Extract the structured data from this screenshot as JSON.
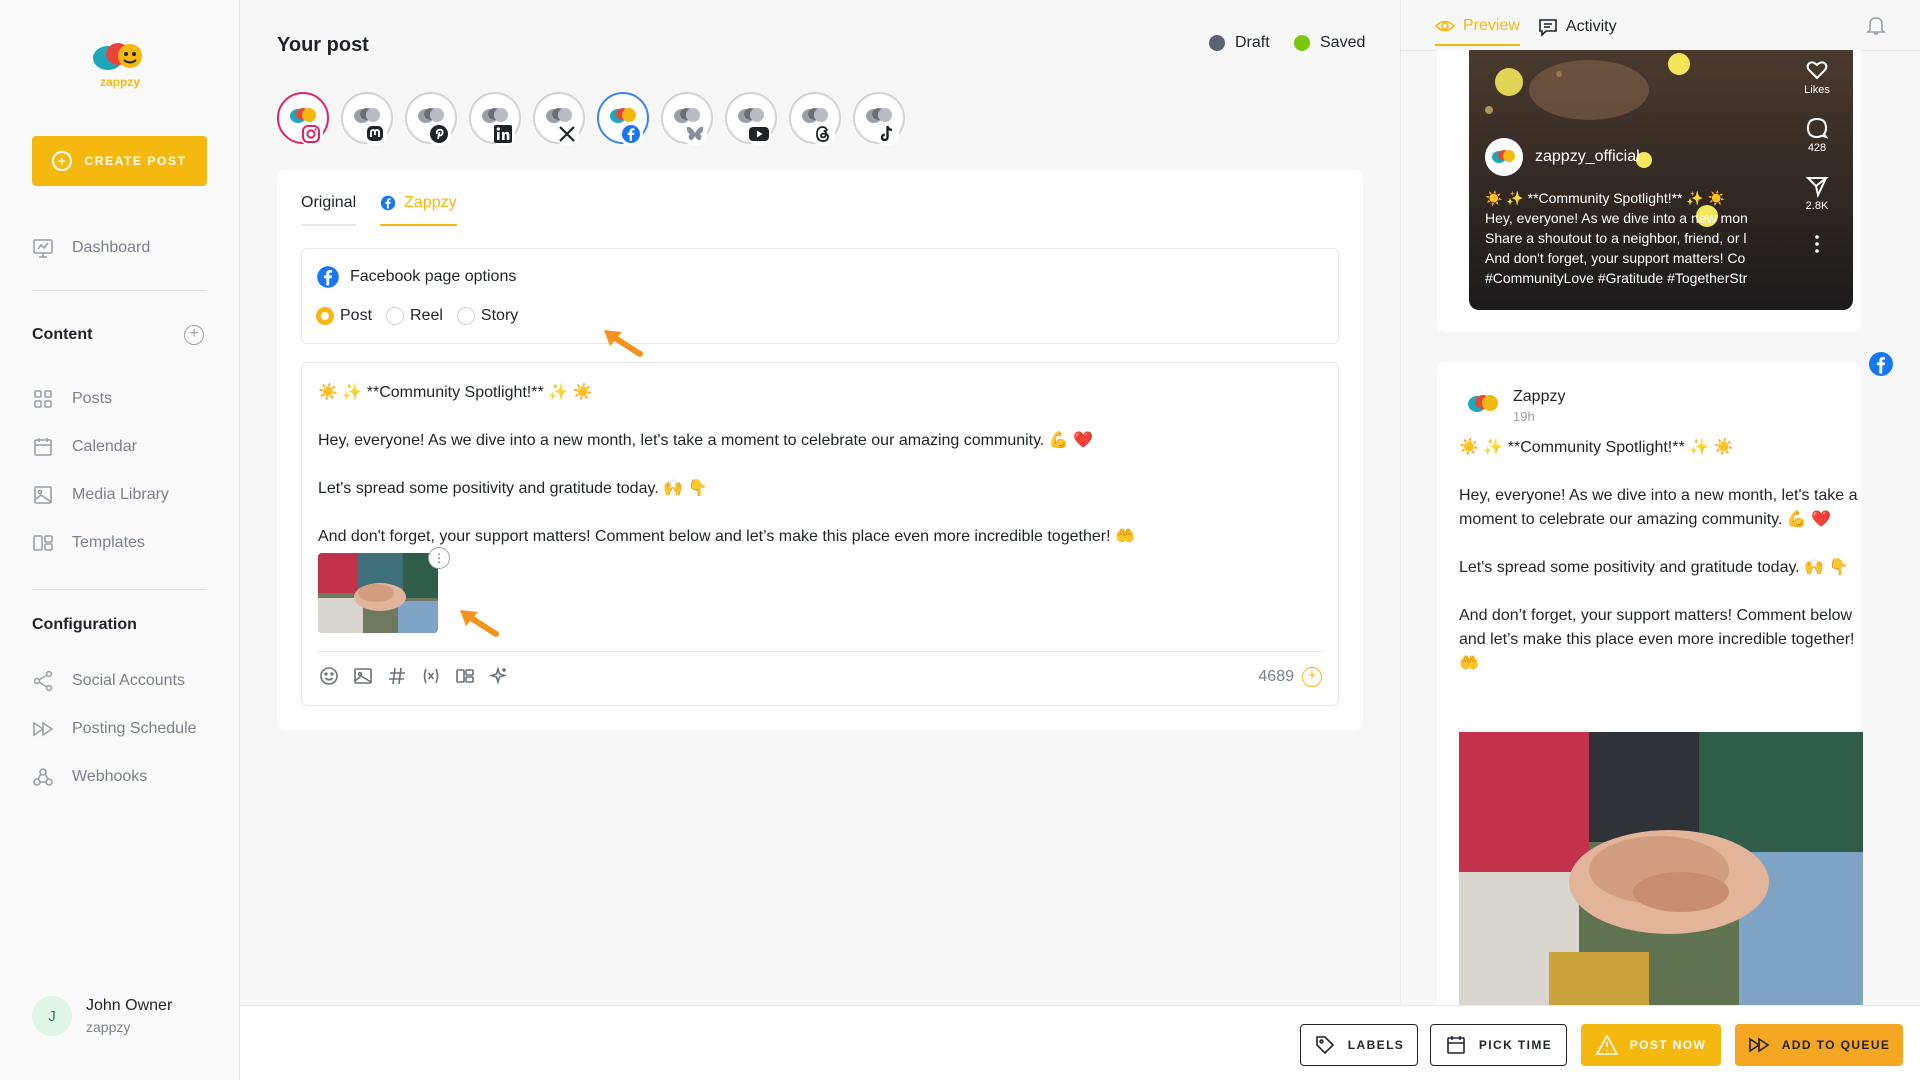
{
  "brand": {
    "name": "zappzy",
    "accent": "#f5b80f"
  },
  "sidebar": {
    "create_label": "CREATE POST",
    "dashboard": "Dashboard",
    "content_title": "Content",
    "content_items": [
      "Posts",
      "Calendar",
      "Media Library",
      "Templates"
    ],
    "config_title": "Configuration",
    "config_items": [
      "Social Accounts",
      "Posting Schedule",
      "Webhooks"
    ],
    "user": {
      "initial": "J",
      "name": "John Owner",
      "org": "zappzy"
    }
  },
  "header": {
    "title": "Your post",
    "status_draft": "Draft",
    "status_saved": "Saved",
    "draft_color": "#5b6270",
    "saved_color": "#7ac70c"
  },
  "accounts": [
    "instagram",
    "mastodon",
    "pinterest",
    "linkedin",
    "x",
    "facebook",
    "bluesky",
    "youtube",
    "threads",
    "tiktok"
  ],
  "editor": {
    "tabs": {
      "original": "Original",
      "zappzy": "Zappzy"
    },
    "fb_options_title": "Facebook page options",
    "radios": {
      "post": "Post",
      "reel": "Reel",
      "story": "Story"
    },
    "lines": [
      "☀️ ✨ **Community Spotlight!** ✨ ☀️",
      "Hey, everyone! As we dive into a new month, let's take a moment to celebrate our amazing community. 💪 ❤️",
      "Let's spread some positivity and gratitude today. 🙌 👇",
      "And don't forget, your support matters! Comment below and let’s make this place even more incredible together! 🤲"
    ],
    "char_count": "4689"
  },
  "preview": {
    "tab_preview": "Preview",
    "tab_activity": "Activity",
    "reel": {
      "username": "zappzy_official",
      "likes_label": "Likes",
      "comments": "428",
      "shares": "2.8K",
      "lines": [
        "☀️ ✨ **Community Spotlight!** ✨ ☀️",
        "Hey, everyone! As we dive into a new mon",
        "Share a shoutout to a neighbor, friend, or l",
        "And don't forget, your support matters! Co",
        "#CommunityLove #Gratitude #TogetherStr"
      ]
    },
    "fb": {
      "name": "Zappzy",
      "time": "19h",
      "lines": [
        "☀️ ✨ **Community Spotlight!** ✨ ☀️",
        "Hey, everyone! As we dive into a new month, let's take a moment to celebrate our amazing community. 💪 ❤️",
        "Let's spread some positivity and gratitude today. 🙌 👇",
        "And don’t forget, your support matters! Comment below and let’s make this place even more incredible together! 🤲"
      ]
    }
  },
  "actions": {
    "labels": "LABELS",
    "pick_time": "PICK TIME",
    "post_now": "POST NOW",
    "add_queue": "ADD TO QUEUE"
  }
}
